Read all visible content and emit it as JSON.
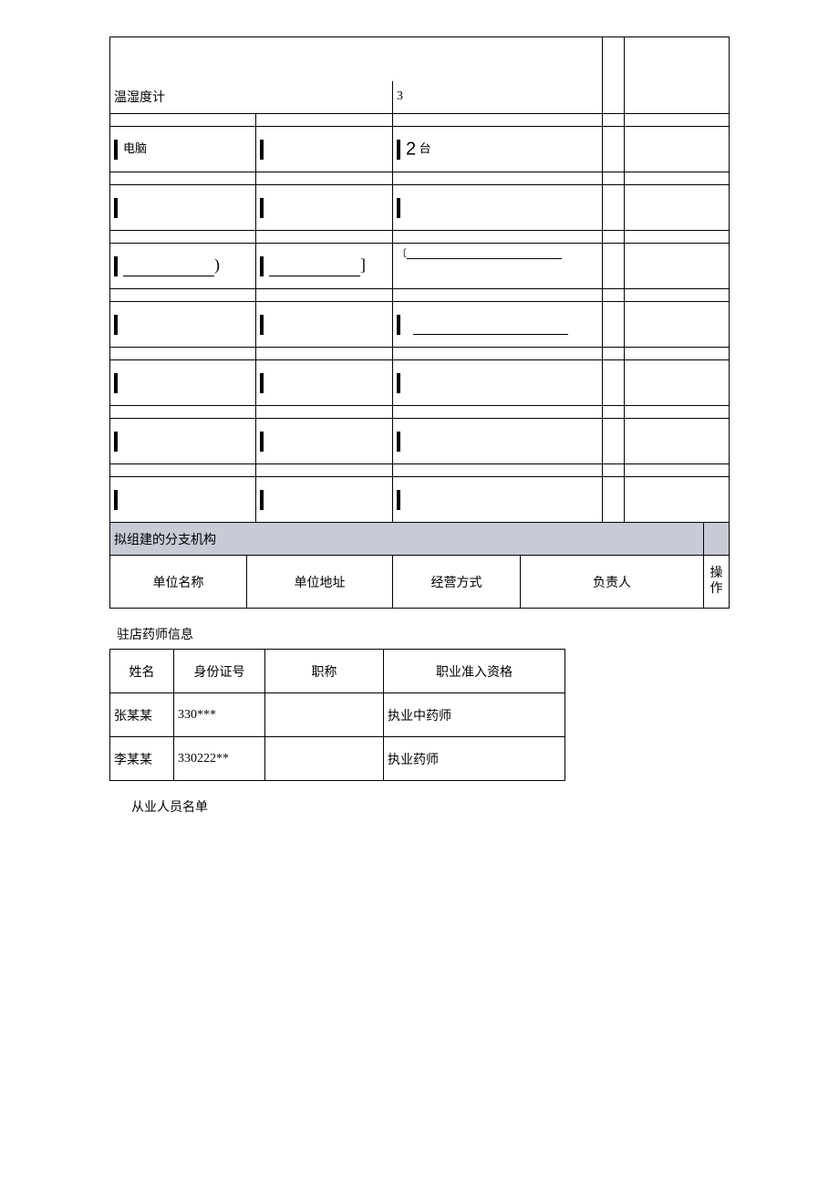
{
  "equipment": {
    "rows": [
      {
        "name": "温湿度计",
        "spec": "",
        "qty": "3",
        "c4": "",
        "c5": ""
      },
      {
        "name": "电脑",
        "spec": "",
        "qty": "2",
        "unit": "台",
        "c4": "",
        "c5": ""
      }
    ]
  },
  "branch": {
    "title": "拟组建的分支机构",
    "headers": {
      "h1": "单位名称",
      "h2": "单位地址",
      "h3": "经营方式",
      "h4": "负责人",
      "h5": "操作"
    }
  },
  "pharmacist": {
    "title": "驻店药师信息",
    "headers": {
      "h1": "姓名",
      "h2": "身份证号",
      "h3": "职称",
      "h4": "职业准入资格"
    },
    "rows": [
      {
        "name": "张某某",
        "id": "330***",
        "title": "",
        "qual": "执业中药师"
      },
      {
        "name": "李某某",
        "id": "330222**",
        "title": "",
        "qual": "执业药师"
      }
    ]
  },
  "staff": {
    "title": "从业人员名单"
  }
}
